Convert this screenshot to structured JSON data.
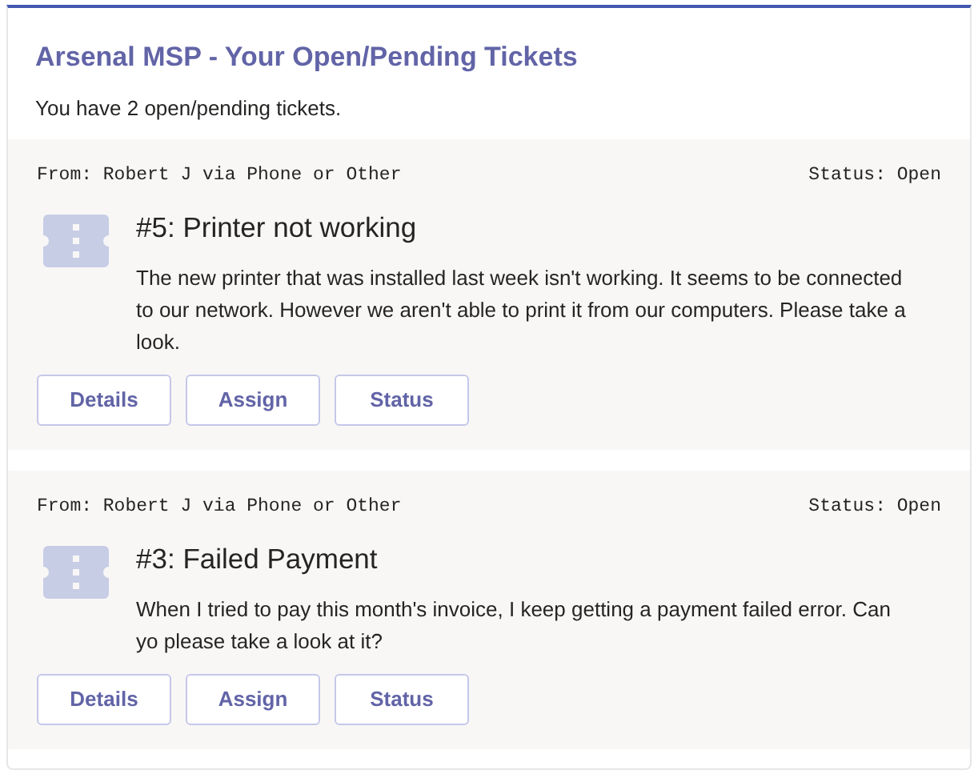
{
  "card": {
    "title": "Arsenal MSP - Your Open/Pending Tickets",
    "summary": "You have 2 open/pending tickets."
  },
  "tickets": [
    {
      "from": "From: Robert J via Phone or Other",
      "status": "Status: Open",
      "title": "#5: Printer not working",
      "description": "The new printer that was installed last week isn't working. It seems to be connected to our network. However we aren't able to print it from our computers. Please take a look.",
      "buttons": [
        "Details",
        "Assign",
        "Status"
      ]
    },
    {
      "from": "From: Robert J via Phone or Other",
      "status": "Status: Open",
      "title": "#3: Failed Payment",
      "description": "When I tried to pay this month's invoice, I keep getting a payment failed error. Can yo please take a look at it?",
      "buttons": [
        "Details",
        "Assign",
        "Status"
      ]
    }
  ]
}
